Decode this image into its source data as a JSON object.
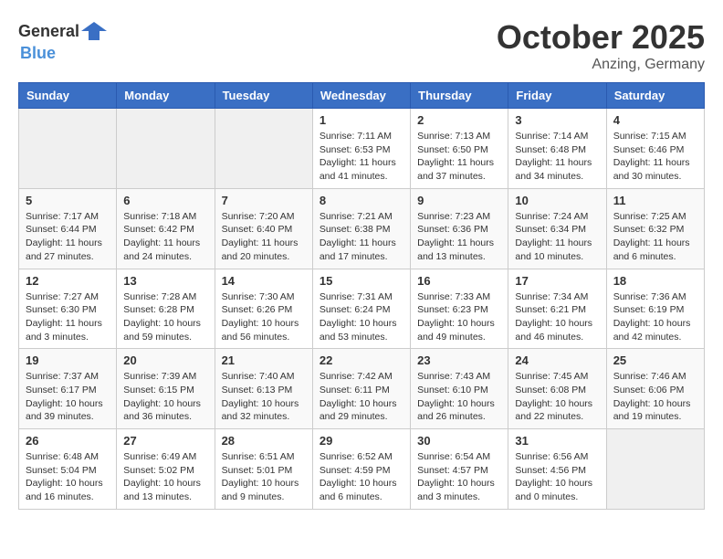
{
  "header": {
    "logo_general": "General",
    "logo_blue": "Blue",
    "month": "October 2025",
    "location": "Anzing, Germany"
  },
  "weekdays": [
    "Sunday",
    "Monday",
    "Tuesday",
    "Wednesday",
    "Thursday",
    "Friday",
    "Saturday"
  ],
  "weeks": [
    [
      {
        "day": "",
        "info": ""
      },
      {
        "day": "",
        "info": ""
      },
      {
        "day": "",
        "info": ""
      },
      {
        "day": "1",
        "info": "Sunrise: 7:11 AM\nSunset: 6:53 PM\nDaylight: 11 hours and 41 minutes."
      },
      {
        "day": "2",
        "info": "Sunrise: 7:13 AM\nSunset: 6:50 PM\nDaylight: 11 hours and 37 minutes."
      },
      {
        "day": "3",
        "info": "Sunrise: 7:14 AM\nSunset: 6:48 PM\nDaylight: 11 hours and 34 minutes."
      },
      {
        "day": "4",
        "info": "Sunrise: 7:15 AM\nSunset: 6:46 PM\nDaylight: 11 hours and 30 minutes."
      }
    ],
    [
      {
        "day": "5",
        "info": "Sunrise: 7:17 AM\nSunset: 6:44 PM\nDaylight: 11 hours and 27 minutes."
      },
      {
        "day": "6",
        "info": "Sunrise: 7:18 AM\nSunset: 6:42 PM\nDaylight: 11 hours and 24 minutes."
      },
      {
        "day": "7",
        "info": "Sunrise: 7:20 AM\nSunset: 6:40 PM\nDaylight: 11 hours and 20 minutes."
      },
      {
        "day": "8",
        "info": "Sunrise: 7:21 AM\nSunset: 6:38 PM\nDaylight: 11 hours and 17 minutes."
      },
      {
        "day": "9",
        "info": "Sunrise: 7:23 AM\nSunset: 6:36 PM\nDaylight: 11 hours and 13 minutes."
      },
      {
        "day": "10",
        "info": "Sunrise: 7:24 AM\nSunset: 6:34 PM\nDaylight: 11 hours and 10 minutes."
      },
      {
        "day": "11",
        "info": "Sunrise: 7:25 AM\nSunset: 6:32 PM\nDaylight: 11 hours and 6 minutes."
      }
    ],
    [
      {
        "day": "12",
        "info": "Sunrise: 7:27 AM\nSunset: 6:30 PM\nDaylight: 11 hours and 3 minutes."
      },
      {
        "day": "13",
        "info": "Sunrise: 7:28 AM\nSunset: 6:28 PM\nDaylight: 10 hours and 59 minutes."
      },
      {
        "day": "14",
        "info": "Sunrise: 7:30 AM\nSunset: 6:26 PM\nDaylight: 10 hours and 56 minutes."
      },
      {
        "day": "15",
        "info": "Sunrise: 7:31 AM\nSunset: 6:24 PM\nDaylight: 10 hours and 53 minutes."
      },
      {
        "day": "16",
        "info": "Sunrise: 7:33 AM\nSunset: 6:23 PM\nDaylight: 10 hours and 49 minutes."
      },
      {
        "day": "17",
        "info": "Sunrise: 7:34 AM\nSunset: 6:21 PM\nDaylight: 10 hours and 46 minutes."
      },
      {
        "day": "18",
        "info": "Sunrise: 7:36 AM\nSunset: 6:19 PM\nDaylight: 10 hours and 42 minutes."
      }
    ],
    [
      {
        "day": "19",
        "info": "Sunrise: 7:37 AM\nSunset: 6:17 PM\nDaylight: 10 hours and 39 minutes."
      },
      {
        "day": "20",
        "info": "Sunrise: 7:39 AM\nSunset: 6:15 PM\nDaylight: 10 hours and 36 minutes."
      },
      {
        "day": "21",
        "info": "Sunrise: 7:40 AM\nSunset: 6:13 PM\nDaylight: 10 hours and 32 minutes."
      },
      {
        "day": "22",
        "info": "Sunrise: 7:42 AM\nSunset: 6:11 PM\nDaylight: 10 hours and 29 minutes."
      },
      {
        "day": "23",
        "info": "Sunrise: 7:43 AM\nSunset: 6:10 PM\nDaylight: 10 hours and 26 minutes."
      },
      {
        "day": "24",
        "info": "Sunrise: 7:45 AM\nSunset: 6:08 PM\nDaylight: 10 hours and 22 minutes."
      },
      {
        "day": "25",
        "info": "Sunrise: 7:46 AM\nSunset: 6:06 PM\nDaylight: 10 hours and 19 minutes."
      }
    ],
    [
      {
        "day": "26",
        "info": "Sunrise: 6:48 AM\nSunset: 5:04 PM\nDaylight: 10 hours and 16 minutes."
      },
      {
        "day": "27",
        "info": "Sunrise: 6:49 AM\nSunset: 5:02 PM\nDaylight: 10 hours and 13 minutes."
      },
      {
        "day": "28",
        "info": "Sunrise: 6:51 AM\nSunset: 5:01 PM\nDaylight: 10 hours and 9 minutes."
      },
      {
        "day": "29",
        "info": "Sunrise: 6:52 AM\nSunset: 4:59 PM\nDaylight: 10 hours and 6 minutes."
      },
      {
        "day": "30",
        "info": "Sunrise: 6:54 AM\nSunset: 4:57 PM\nDaylight: 10 hours and 3 minutes."
      },
      {
        "day": "31",
        "info": "Sunrise: 6:56 AM\nSunset: 4:56 PM\nDaylight: 10 hours and 0 minutes."
      },
      {
        "day": "",
        "info": ""
      }
    ]
  ]
}
